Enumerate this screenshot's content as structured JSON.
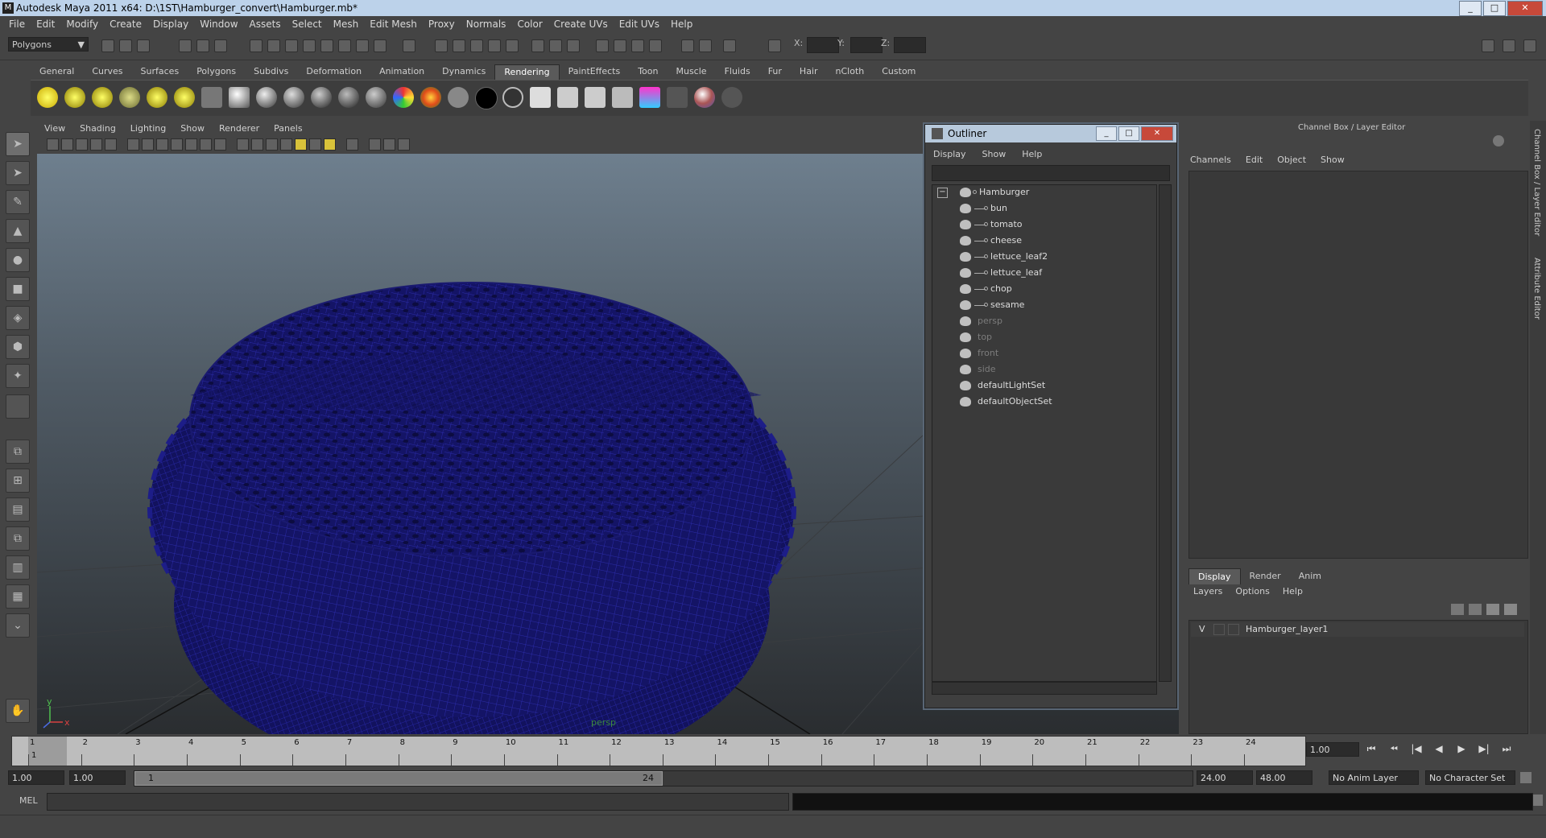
{
  "window": {
    "title": "Autodesk Maya 2011 x64: D:\\1ST\\Hamburger_convert\\Hamburger.mb*",
    "min": "_",
    "max": "□",
    "close": "✕"
  },
  "menubar": [
    "File",
    "Edit",
    "Modify",
    "Create",
    "Display",
    "Window",
    "Assets",
    "Select",
    "Mesh",
    "Edit Mesh",
    "Proxy",
    "Normals",
    "Color",
    "Create UVs",
    "Edit UVs",
    "Help"
  ],
  "status": {
    "mode": "Polygons",
    "mode_arrow": "▼",
    "x_label": "X:",
    "y_label": "Y:",
    "z_label": "Z:"
  },
  "shelf_tabs": [
    "General",
    "Curves",
    "Surfaces",
    "Polygons",
    "Subdivs",
    "Deformation",
    "Animation",
    "Dynamics",
    "Rendering",
    "PaintEffects",
    "Toon",
    "Muscle",
    "Fluids",
    "Fur",
    "Hair",
    "nCloth",
    "Custom"
  ],
  "active_shelf_tab": "Rendering",
  "viewport": {
    "menu": [
      "View",
      "Shading",
      "Lighting",
      "Show",
      "Renderer",
      "Panels"
    ],
    "camera": "persp",
    "axis_x": "x",
    "axis_y": "y",
    "wire_color": "#1a1a7a"
  },
  "outliner": {
    "title": "Outliner",
    "menu": [
      "Display",
      "Show",
      "Help"
    ],
    "expand_toggle": "−",
    "items": [
      {
        "label": "Hamburger",
        "depth": 0,
        "dim": false
      },
      {
        "label": "bun",
        "depth": 1,
        "dim": false
      },
      {
        "label": "tomato",
        "depth": 1,
        "dim": false
      },
      {
        "label": "cheese",
        "depth": 1,
        "dim": false
      },
      {
        "label": "lettuce_leaf2",
        "depth": 1,
        "dim": false
      },
      {
        "label": "lettuce_leaf",
        "depth": 1,
        "dim": false
      },
      {
        "label": "chop",
        "depth": 1,
        "dim": false
      },
      {
        "label": "sesame",
        "depth": 1,
        "dim": false
      },
      {
        "label": "persp",
        "depth": 0,
        "dim": true
      },
      {
        "label": "top",
        "depth": 0,
        "dim": true
      },
      {
        "label": "front",
        "depth": 0,
        "dim": true
      },
      {
        "label": "side",
        "depth": 0,
        "dim": true
      },
      {
        "label": "defaultLightSet",
        "depth": 0,
        "dim": false
      },
      {
        "label": "defaultObjectSet",
        "depth": 0,
        "dim": false
      }
    ]
  },
  "channel_box": {
    "title": "Channel Box / Layer Editor",
    "menu": [
      "Channels",
      "Edit",
      "Object",
      "Show"
    ],
    "layer_tabs": [
      "Display",
      "Render",
      "Anim"
    ],
    "active_layer_tab": "Display",
    "layer_menu": [
      "Layers",
      "Options",
      "Help"
    ],
    "layers": [
      {
        "visible": "V",
        "name": "Hamburger_layer1"
      }
    ],
    "side_tabs": [
      "Channel Box / Layer Editor",
      "Attribute Editor"
    ]
  },
  "timeline": {
    "ticks": [
      1,
      2,
      3,
      4,
      5,
      6,
      7,
      8,
      9,
      10,
      11,
      12,
      13,
      14,
      15,
      16,
      17,
      18,
      19,
      20,
      21,
      22,
      23,
      24
    ],
    "current_marker": "1",
    "current_frame": "1.00"
  },
  "playback_icons": [
    "⏮",
    "⏪︎",
    "|◀",
    "◀",
    "▶",
    "▶|",
    "⏭"
  ],
  "range": {
    "start": "1.00",
    "playback_start": "1.00",
    "handle_start": "1",
    "handle_end": "24",
    "playback_end": "24.00",
    "end": "48.00",
    "anim_layer": "No Anim Layer",
    "character_set": "No Character Set"
  },
  "commandline": {
    "label": "MEL"
  }
}
